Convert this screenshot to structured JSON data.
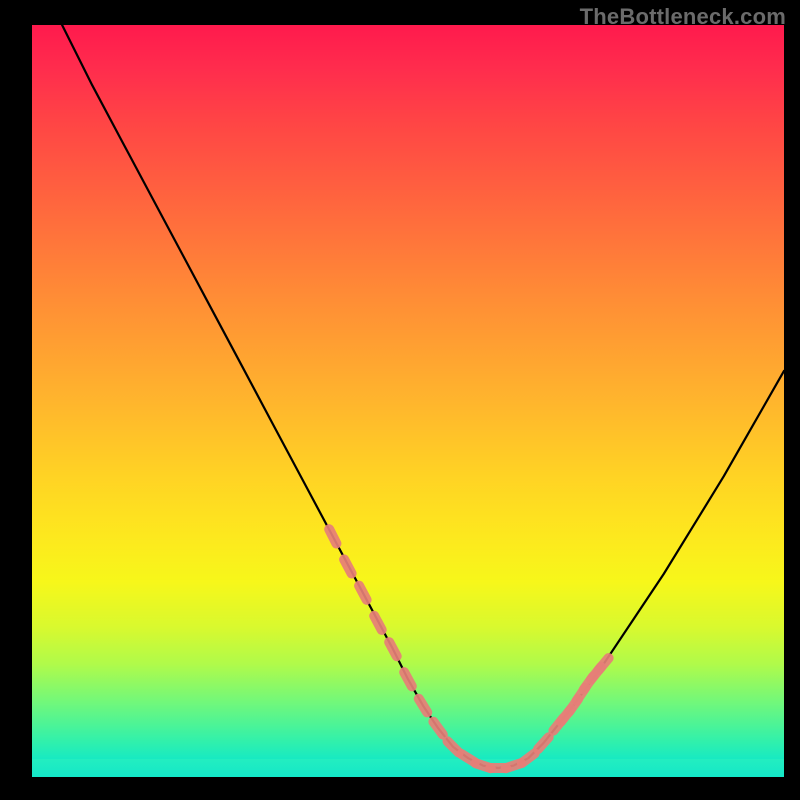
{
  "watermark": "TheBottleneck.com",
  "colors": {
    "page_bg": "#000000",
    "curve": "#000000",
    "marker_fill": "#e77f78",
    "marker_stroke": "#c25d56"
  },
  "chart_data": {
    "type": "line",
    "title": "",
    "xlabel": "",
    "ylabel": "",
    "xlim": [
      0,
      100
    ],
    "ylim": [
      0,
      100
    ],
    "grid": false,
    "legend": false,
    "series": [
      {
        "name": "bottleneck-curve",
        "x": [
          4,
          8,
          12,
          16,
          20,
          24,
          28,
          32,
          36,
          40,
          44,
          48,
          50,
          52,
          54,
          56,
          58,
          60,
          62,
          64,
          66,
          68,
          72,
          76,
          80,
          84,
          88,
          92,
          96,
          100
        ],
        "y": [
          100,
          92,
          84.5,
          77,
          69.5,
          62,
          54.5,
          47,
          39.5,
          32,
          24.5,
          17,
          13,
          9.5,
          6.5,
          4,
          2.5,
          1.5,
          1.2,
          1.5,
          2.5,
          4.5,
          9.5,
          15,
          21,
          27,
          33.5,
          40,
          47,
          54
        ]
      }
    ],
    "markers": {
      "name": "highlight-segments",
      "x": [
        40,
        42,
        44,
        46,
        48,
        50,
        52,
        54,
        56,
        58,
        60,
        62,
        64,
        66,
        68,
        70,
        71,
        72,
        73,
        74,
        75,
        76
      ],
      "y": [
        32,
        28,
        24.5,
        20.5,
        17,
        13,
        9.5,
        6.5,
        4,
        2.5,
        1.5,
        1.2,
        1.5,
        2.5,
        4.5,
        7,
        8.2,
        9.5,
        11,
        12.5,
        13.8,
        15
      ]
    }
  }
}
